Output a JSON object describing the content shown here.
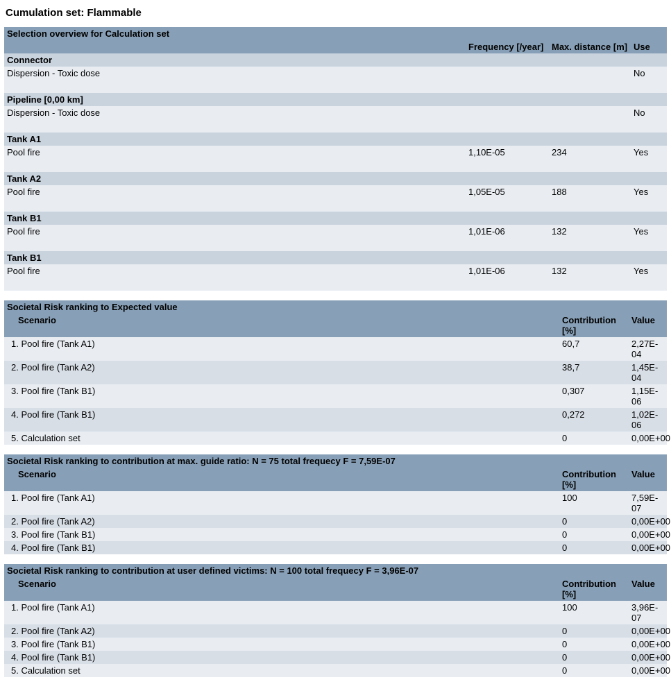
{
  "title": "Cumulation set: Flammable",
  "selection_overview": {
    "heading": "Selection overview for Calculation set",
    "columns": {
      "freq": "Frequency [/year]",
      "dist": "Max. distance [m]",
      "use": "Use"
    },
    "groups": [
      {
        "name": "Connector",
        "rows": [
          {
            "label": "Dispersion - Toxic dose",
            "freq": "",
            "dist": "",
            "use": "No"
          }
        ]
      },
      {
        "name": "Pipeline [0,00 km]",
        "rows": [
          {
            "label": "Dispersion - Toxic dose",
            "freq": "",
            "dist": "",
            "use": "No"
          }
        ]
      },
      {
        "name": "Tank A1",
        "rows": [
          {
            "label": "Pool fire",
            "freq": "1,10E-05",
            "dist": "234",
            "use": "Yes"
          }
        ]
      },
      {
        "name": "Tank A2",
        "rows": [
          {
            "label": "Pool fire",
            "freq": "1,05E-05",
            "dist": "188",
            "use": "Yes"
          }
        ]
      },
      {
        "name": "Tank B1",
        "rows": [
          {
            "label": "Pool fire",
            "freq": "1,01E-06",
            "dist": "132",
            "use": "Yes"
          }
        ]
      },
      {
        "name": "Tank B1",
        "rows": [
          {
            "label": "Pool fire",
            "freq": "1,01E-06",
            "dist": "132",
            "use": "Yes"
          }
        ]
      }
    ]
  },
  "rankings": [
    {
      "heading": "Societal Risk ranking to Expected value",
      "scenario_label": "Scenario",
      "columns": {
        "contrib": "Contribution [%]",
        "value": "Value"
      },
      "rows": [
        {
          "n": "1.",
          "label": "Pool fire (Tank A1)",
          "contrib": "60,7",
          "value": "2,27E-04"
        },
        {
          "n": "2.",
          "label": "Pool fire (Tank A2)",
          "contrib": "38,7",
          "value": "1,45E-04"
        },
        {
          "n": "3.",
          "label": "Pool fire (Tank B1)",
          "contrib": "0,307",
          "value": "1,15E-06"
        },
        {
          "n": "4.",
          "label": "Pool fire (Tank B1)",
          "contrib": "0,272",
          "value": "1,02E-06"
        },
        {
          "n": "5.",
          "label": "Calculation set",
          "contrib": "0",
          "value": "0,00E+00"
        }
      ]
    },
    {
      "heading": "Societal Risk ranking to contribution at max. guide ratio: N = 75 total frequecy F = 7,59E-07",
      "scenario_label": "Scenario",
      "columns": {
        "contrib": "Contribution [%]",
        "value": "Value"
      },
      "rows": [
        {
          "n": "1.",
          "label": "Pool fire (Tank A1)",
          "contrib": "100",
          "value": "7,59E-07"
        },
        {
          "n": "2.",
          "label": "Pool fire (Tank A2)",
          "contrib": "0",
          "value": "0,00E+00"
        },
        {
          "n": "3.",
          "label": "Pool fire (Tank B1)",
          "contrib": "0",
          "value": "0,00E+00"
        },
        {
          "n": "4.",
          "label": "Pool fire (Tank B1)",
          "contrib": "0",
          "value": "0,00E+00"
        }
      ]
    },
    {
      "heading": "Societal Risk ranking to contribution at user defined victims: N = 100 total frequecy F = 3,96E-07",
      "scenario_label": "Scenario",
      "columns": {
        "contrib": "Contribution [%]",
        "value": "Value"
      },
      "rows": [
        {
          "n": "1.",
          "label": "Pool fire (Tank A1)",
          "contrib": "100",
          "value": "3,96E-07"
        },
        {
          "n": "2.",
          "label": "Pool fire (Tank A2)",
          "contrib": "0",
          "value": "0,00E+00"
        },
        {
          "n": "3.",
          "label": "Pool fire (Tank B1)",
          "contrib": "0",
          "value": "0,00E+00"
        },
        {
          "n": "4.",
          "label": "Pool fire (Tank B1)",
          "contrib": "0",
          "value": "0,00E+00"
        },
        {
          "n": "5.",
          "label": "Calculation set",
          "contrib": "0",
          "value": "0,00E+00"
        }
      ]
    }
  ]
}
